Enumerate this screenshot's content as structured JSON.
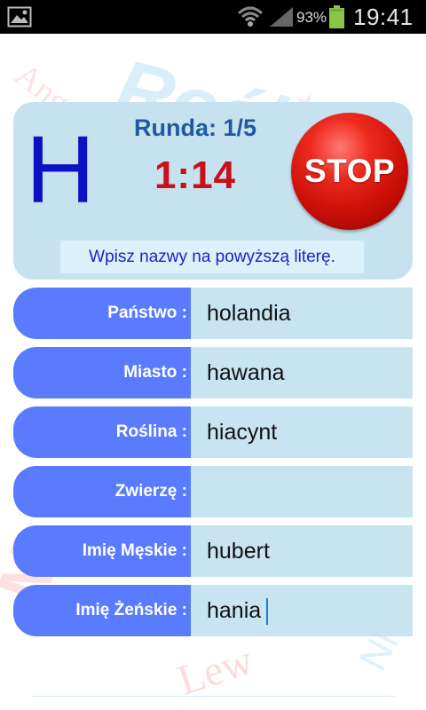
{
  "statusbar": {
    "battery_percent": "93%",
    "clock": "19:41",
    "icons": [
      "gallery-icon",
      "wifi-icon",
      "signal-icon",
      "battery-icon"
    ]
  },
  "game": {
    "letter": "H",
    "round": "Runda: 1/5",
    "timer": "1:14",
    "stop_label": "STOP",
    "hint": "Wpisz nazwy na powyższą literę."
  },
  "fields": [
    {
      "label": "Państwo :",
      "value": "holandia"
    },
    {
      "label": "Miasto :",
      "value": "hawana"
    },
    {
      "label": "Roślina :",
      "value": "hiacynt"
    },
    {
      "label": "Zwierzę :",
      "value": ""
    },
    {
      "label": "Imię Męskie :",
      "value": "hubert"
    },
    {
      "label": "Imię Żeńskie :",
      "value": "hania"
    }
  ],
  "colors": {
    "letter": "#0b12c4",
    "round": "#1e5aa0",
    "timer": "#c8101c",
    "stop": "#e01810",
    "label_bg": "#5b7bff",
    "input_bg": "#c4e2f0",
    "panel_bg": "#c6e2ef"
  }
}
